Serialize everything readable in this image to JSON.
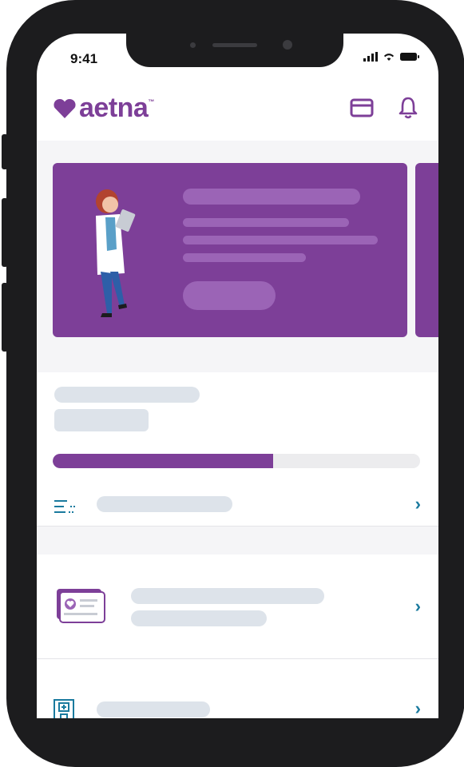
{
  "status_bar": {
    "time": "9:41"
  },
  "header": {
    "logo_text": "aetna",
    "trademark": "™"
  },
  "hero": {
    "progress_fraction": 0.6
  },
  "links": {
    "chevron": "›"
  },
  "icons": {
    "id_card": "id-card-icon",
    "bell": "bell-icon",
    "list": "list-icon",
    "member_card": "member-card-icon",
    "hospital": "hospital-icon"
  },
  "colors": {
    "brand": "#7d3f98",
    "accent": "#1a7a9e",
    "placeholder": "#dde3ea"
  }
}
